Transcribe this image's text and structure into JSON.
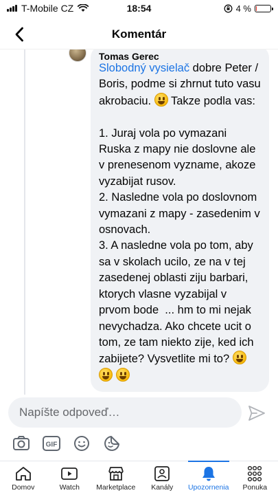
{
  "status_bar": {
    "carrier": "T-Mobile CZ",
    "time": "18:54",
    "battery_percent": "4 %",
    "battery_level": 0.04
  },
  "header": {
    "title": "Komentár"
  },
  "comment": {
    "author": "Tomas Gerec",
    "mention": "Slobodný vysielač",
    "text_1": " dobre Peter / Boris, podme si zhrnut tuto vasu akrobaciu. ",
    "text_2": " Takze podla vas:\n\n1. Juraj vola po vymazani Ruska z mapy nie doslovne ale v prenesenom vyzname, akoze vyzabijat rusov.\n2. Nasledne vola po doslovnom vymazani z mapy - zasedenim v osnovach.\n3. A nasledne vola po tom, aby sa v skolach ucilo, ze na v tej zasedenej oblasti ziju barbari, ktorych vlasne vyzabijal v prvom bode  ... hm to mi nejak nevychadza. Ako chcete ucit o tom, ze tam niekto zije, ked ich zabijete? Vysvetlite mi to? ",
    "text_3": "\n"
  },
  "reply": {
    "placeholder": "Napíšte odpoveď…"
  },
  "toolbar": {
    "gif_label": "GIF"
  },
  "tabs": [
    {
      "label": "Domov",
      "icon": "home-icon"
    },
    {
      "label": "Watch",
      "icon": "watch-icon"
    },
    {
      "label": "Marketplace",
      "icon": "marketplace-icon"
    },
    {
      "label": "Kanály",
      "icon": "feeds-icon"
    },
    {
      "label": "Upozornenia",
      "icon": "bell-icon",
      "active": true
    },
    {
      "label": "Ponuka",
      "icon": "menu-grid-icon"
    }
  ],
  "colors": {
    "accent": "#1b74e4",
    "bubble": "#f0f2f5",
    "text": "#050505",
    "muted": "#65676b"
  }
}
